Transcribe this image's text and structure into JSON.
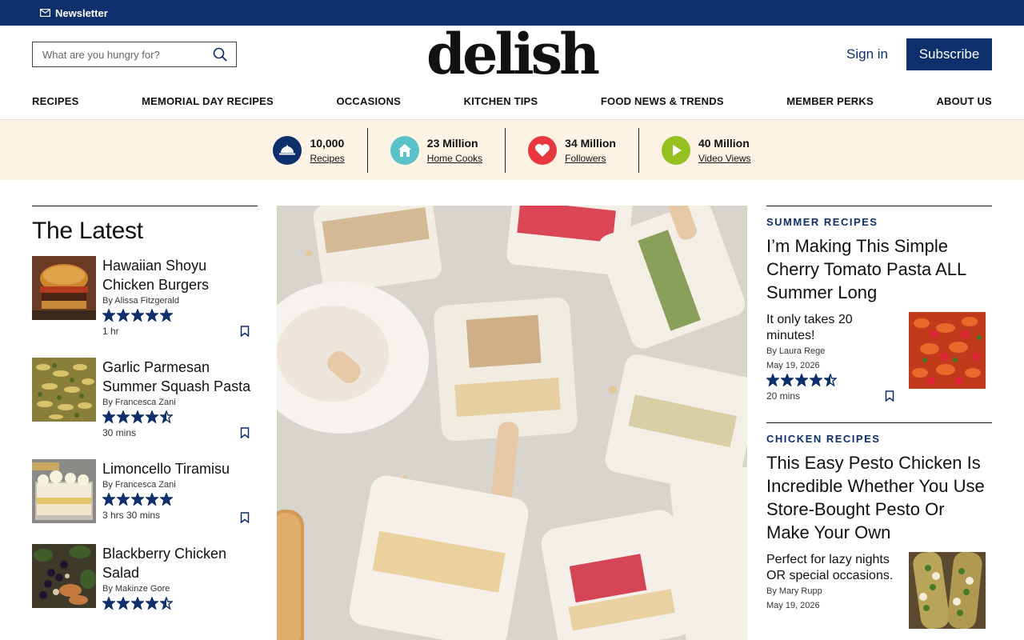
{
  "topbar": {
    "newsletter_label": "Newsletter"
  },
  "header": {
    "search_placeholder": "What are you hungry for?",
    "logo": "delish",
    "signin_label": "Sign in",
    "subscribe_label": "Subscribe"
  },
  "nav": {
    "items": [
      {
        "label": "RECIPES"
      },
      {
        "label": "MEMORIAL DAY RECIPES"
      },
      {
        "label": "OCCASIONS"
      },
      {
        "label": "KITCHEN TIPS"
      },
      {
        "label": "FOOD NEWS & TRENDS"
      },
      {
        "label": "MEMBER PERKS"
      },
      {
        "label": "ABOUT US"
      }
    ]
  },
  "stats": [
    {
      "number": "10,000",
      "label": "Recipes",
      "icon": "cloche-icon",
      "color": "#0d2f6b"
    },
    {
      "number": "23 Million",
      "label": "Home Cooks",
      "icon": "house-icon",
      "color": "#5cc2c9"
    },
    {
      "number": "34 Million",
      "label": "Followers",
      "icon": "heart-icon",
      "color": "#e8373e"
    },
    {
      "number": "40 Million",
      "label": "Video Views",
      "icon": "play-icon",
      "color": "#94c11f"
    }
  ],
  "latest": {
    "title": "The Latest",
    "items": [
      {
        "name": "Hawaiian Shoyu Chicken Burgers",
        "byline": "By Alissa Fitzgerald",
        "rating": 5,
        "time": "1 hr"
      },
      {
        "name": "Garlic Parmesan Summer Squash Pasta",
        "byline": "By Francesca Zani",
        "rating": 4.5,
        "time": "30 mins"
      },
      {
        "name": "Limoncello Tiramisu",
        "byline": "By Francesca Zani",
        "rating": 5,
        "time": "3 hrs 30 mins"
      },
      {
        "name": "Blackberry Chicken Salad",
        "byline": "By Makinze Gore",
        "rating": 4.5,
        "time": ""
      }
    ]
  },
  "right": {
    "sections": [
      {
        "kicker": "SUMMER RECIPES",
        "title": "I’m Making This Simple Cherry Tomato Pasta ALL Summer Long",
        "dek": "It only takes 20 minutes!",
        "byline": "By Laura Rege",
        "date": "May 19, 2026",
        "rating": 4.5,
        "time": "20 mins"
      },
      {
        "kicker": "CHICKEN RECIPES",
        "title": "This Easy Pesto Chicken Is Incredible Whether You Use Store-Bought Pesto Or Make Your Own",
        "dek": "Perfect for lazy nights OR special occasions.",
        "byline": "By Mary Rupp",
        "date": "May 19, 2026"
      }
    ]
  },
  "colors": {
    "brand_navy": "#0d2f6b",
    "stats_bg": "#fdf3e5"
  }
}
